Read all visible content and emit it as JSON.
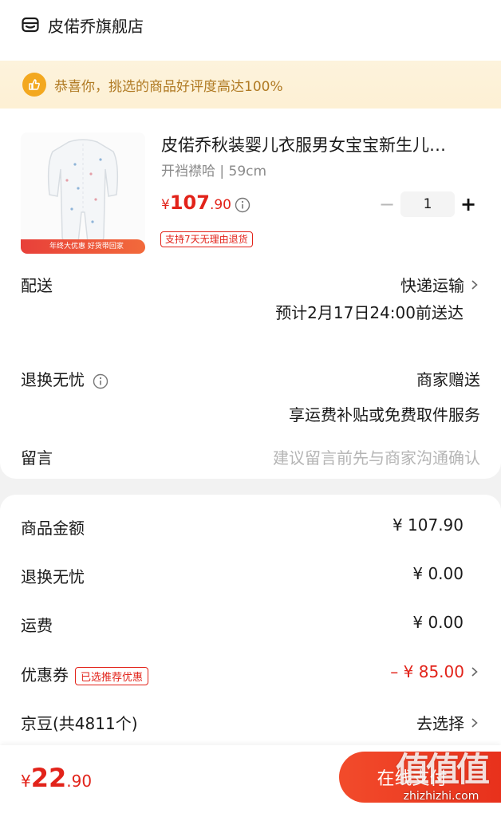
{
  "shop": {
    "name": "皮偌乔旗舰店",
    "icon": "store-icon"
  },
  "praise": {
    "text": "恭喜你，挑选的商品好评度高达100%",
    "icon": "thumbs-up-icon",
    "icon_color": "#f3a81f"
  },
  "product": {
    "banner": "年终大优惠 好货带回家",
    "title": "皮偌乔秋装婴儿衣服男女宝宝新生儿…",
    "spec": "开裆襟哈 | 59cm",
    "price_currency": "¥",
    "price_int": "107",
    "price_dec": ".90",
    "quantity": "1",
    "minus": "−",
    "plus": "+",
    "return_badge": "支持7天无理由退货"
  },
  "delivery": {
    "label": "配送",
    "method": "快递运输",
    "eta": "预计2月17日24:00前送达"
  },
  "returns": {
    "label": "退换无忧",
    "value": "商家赠送",
    "desc": "享运费补贴或免费取件服务"
  },
  "message": {
    "label": "留言",
    "placeholder": "建议留言前先与商家沟通确认"
  },
  "summary": {
    "goods_label": "商品金额",
    "goods_value": "¥ 107.90",
    "returns_label": "退换无忧",
    "returns_value": "¥ 0.00",
    "shipping_label": "运费",
    "shipping_value": "¥ 0.00",
    "coupon_label": "优惠券",
    "coupon_tag": "已选推荐优惠",
    "coupon_value": "– ¥ 85.00",
    "beans_label": "京豆(共4811个)",
    "beans_value": "去选择"
  },
  "footer": {
    "total_currency": "¥",
    "total_int": "22",
    "total_dec": ".90",
    "pay_label": "在线支付"
  },
  "watermark": {
    "big": "值值值",
    "small": "zhizhizhi.com"
  },
  "colors": {
    "accent": "#e2231a",
    "praise_bg": "#fdf3dc",
    "praise_text": "#b07a23"
  }
}
